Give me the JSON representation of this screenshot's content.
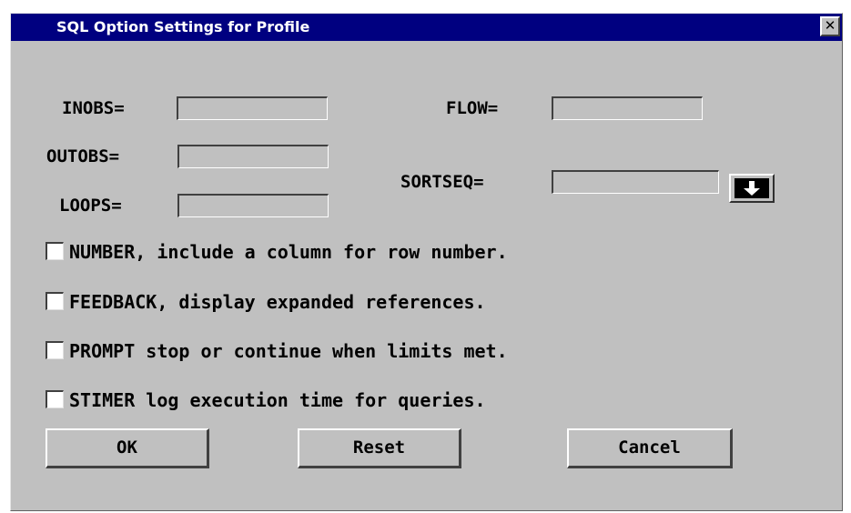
{
  "window": {
    "title": "SQL Option Settings for Profile",
    "close_glyph": "✕"
  },
  "fields": {
    "inobs": {
      "label": "INOBS=",
      "value": ""
    },
    "outobs": {
      "label": "OUTOBS=",
      "value": ""
    },
    "loops": {
      "label": "LOOPS=",
      "value": ""
    },
    "flow": {
      "label": "FLOW=",
      "value": ""
    },
    "sortseq": {
      "label": "SORTSEQ=",
      "value": ""
    }
  },
  "options": [
    {
      "label": "NUMBER, include a column for row number.",
      "checked": false
    },
    {
      "label": "FEEDBACK, display expanded references.",
      "checked": false
    },
    {
      "label": "PROMPT stop or continue when limits met.",
      "checked": false
    },
    {
      "label": "STIMER log execution time for queries.",
      "checked": false
    }
  ],
  "buttons": {
    "ok": "OK",
    "reset": "Reset",
    "cancel": "Cancel"
  },
  "icons": {
    "sortseq_dropdown": "down-arrow-icon"
  },
  "colors": {
    "titlebar": "#000080",
    "dialog": "#c0c0c0"
  }
}
